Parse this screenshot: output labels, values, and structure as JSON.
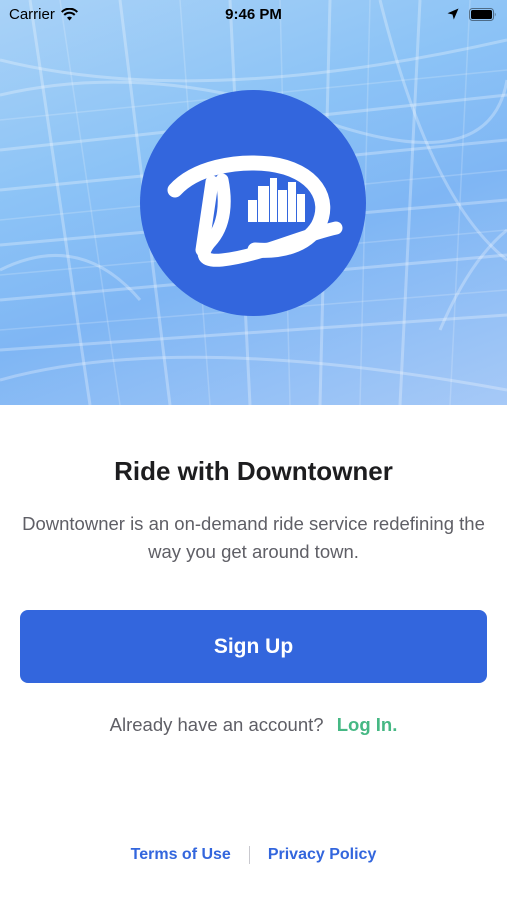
{
  "status_bar": {
    "carrier": "Carrier",
    "time": "9:46 PM",
    "icons": [
      "wifi-icon",
      "location-arrow-icon",
      "battery-icon"
    ]
  },
  "hero": {
    "logo_icon": "downtowner-logo-icon",
    "background_icon": "city-map-icon"
  },
  "content": {
    "title": "Ride with Downtowner",
    "description": "Downtowner is an on-demand ride service redefining the way you get around town.",
    "signup_label": "Sign Up",
    "login_prompt": "Already have an account?",
    "login_label": "Log In."
  },
  "footer": {
    "terms_label": "Terms of Use",
    "privacy_label": "Privacy Policy"
  },
  "colors": {
    "brand_blue": "#3366dd",
    "login_green": "#46b884",
    "text_dark": "#1d1d1f",
    "text_gray": "#5f5f66"
  }
}
